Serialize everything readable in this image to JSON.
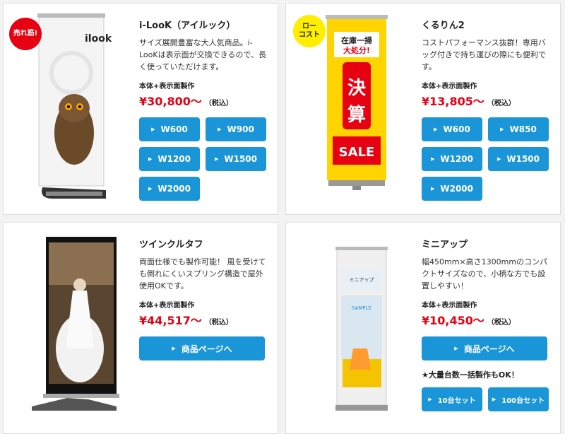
{
  "products": [
    {
      "badge": "売れ筋!",
      "name": "i-LooK（アイルック）",
      "desc": "サイズ展開豊富な大人気商品。i-LooKは表示面が交換できるので、長く使っていただけます。",
      "made_label": "本体+表示面製作",
      "price": "¥30,800〜",
      "tax": "（税込）",
      "image_logo": "ilook",
      "buttons": [
        "W600",
        "W900",
        "W1200",
        "W1500",
        "W2000"
      ]
    },
    {
      "badge": "ロー\nコスト",
      "name": "くるりん2",
      "desc": "コストパフォーマンス抜群！専用バッグ付きで持ち運びの際にも便利です。",
      "made_label": "本体+表示面製作",
      "price": "¥13,805〜",
      "tax": "（税込）",
      "image_text": {
        "top": "在庫一掃\n大処分!",
        "main": "決\n算",
        "bottom": "SALE"
      },
      "buttons": [
        "W600",
        "W850",
        "W1200",
        "W1500",
        "W2000"
      ]
    },
    {
      "name": "ツインクルタフ",
      "desc": "両面仕様でも製作可能！ 風を受けても倒れにくいスプリング構造で屋外使用OKです。",
      "made_label": "本体+表示面製作",
      "price": "¥44,517〜",
      "tax": "（税込）",
      "buttons": [
        "商品ページへ"
      ]
    },
    {
      "name": "ミニアップ",
      "desc": "幅450mm×高さ1300mmのコンパクトサイズなので、小柄な方でも設置しやすい！",
      "made_label": "本体+表示面製作",
      "price": "¥10,450〜",
      "tax": "（税込）",
      "buttons": [
        "商品ページへ"
      ],
      "image_text": {
        "title": "ミニアップ",
        "sample": "SAMPLE"
      },
      "note": "★大量台数一括製作もOK！",
      "bulk_buttons": [
        "10台セット",
        "100台セット"
      ]
    }
  ],
  "colors": {
    "button": "#1a95d8",
    "price": "#e60012"
  },
  "icons": {
    "button_arrow": "play-triangle-icon"
  }
}
